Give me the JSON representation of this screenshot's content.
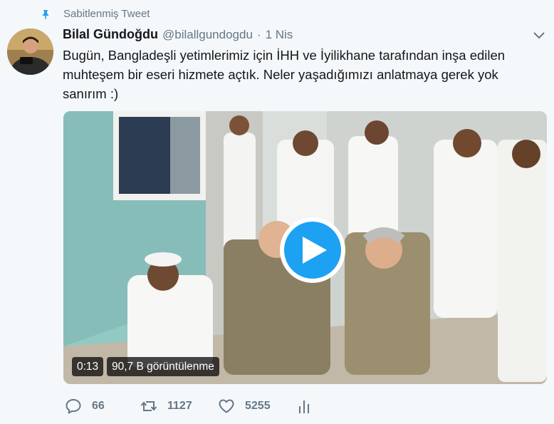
{
  "pinned_label": "Sabitlenmiş Tweet",
  "author": {
    "name": "Bilal Gündoğdu",
    "handle": "@bilallgundogdu",
    "separator": "·",
    "date": "1 Nis"
  },
  "tweet_text": "Bugün, Bangladeşli yetimlerimiz için İHH ve İyilikhane tarafından inşa edilen muhteşem bir eseri hizmete açtık. Neler yaşadığımızı anlatmaya gerek yok sanırım :)",
  "video": {
    "duration": "0:13",
    "views": "90,7 B görüntülenme"
  },
  "actions": {
    "reply_count": "66",
    "retweet_count": "1127",
    "like_count": "5255"
  },
  "colors": {
    "accent": "#1da1f2",
    "secondary_text": "#657786",
    "primary_text": "#14171a",
    "background": "#f5f8fa"
  },
  "icons": [
    "pin-icon",
    "chevron-down-icon",
    "play-icon",
    "reply-icon",
    "retweet-icon",
    "like-icon",
    "stats-icon"
  ]
}
